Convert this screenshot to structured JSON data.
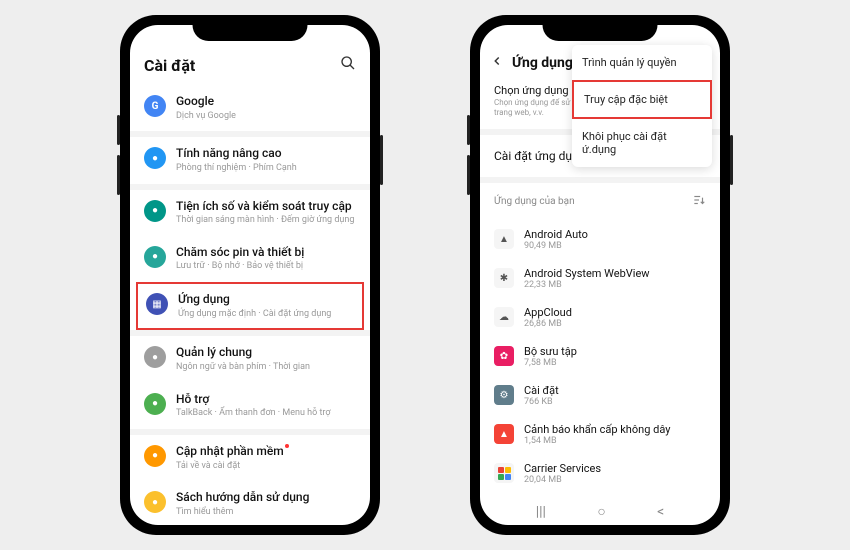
{
  "phone1": {
    "header": {
      "title": "Cài đặt"
    },
    "groups": [
      {
        "items": [
          {
            "title": "Google",
            "sub": "Dịch vụ Google",
            "icon": "google-icon",
            "bg": "bg-blue-g"
          }
        ]
      },
      {
        "items": [
          {
            "title": "Tính năng nâng cao",
            "sub": "Phòng thí nghiệm · Phím Cạnh",
            "icon": "advanced-icon",
            "bg": "bg-blue"
          }
        ]
      },
      {
        "items": [
          {
            "title": "Tiện ích số và kiểm soát truy cập",
            "sub": "Thời gian sáng màn hình · Đếm giờ ứng dụng",
            "icon": "wellbeing-icon",
            "bg": "bg-teal"
          },
          {
            "title": "Chăm sóc pin và thiết bị",
            "sub": "Lưu trữ · Bộ nhớ · Bảo vệ thiết bị",
            "icon": "battery-icon",
            "bg": "bg-teal2"
          },
          {
            "title": "Ứng dụng",
            "sub": "Ứng dụng mặc định · Cài đặt ứng dụng",
            "icon": "apps-icon",
            "bg": "bg-indigo",
            "highlight": true
          }
        ]
      },
      {
        "items": [
          {
            "title": "Quản lý chung",
            "sub": "Ngôn ngữ và bàn phím · Thời gian",
            "icon": "general-icon",
            "bg": "bg-grey"
          },
          {
            "title": "Hỗ trợ",
            "sub": "TalkBack · Ẩm thanh đơn · Menu hỗ trợ",
            "icon": "accessibility-icon",
            "bg": "bg-green"
          }
        ]
      },
      {
        "items": [
          {
            "title": "Cập nhật phần mềm",
            "sub": "Tải về và cài đặt",
            "icon": "update-icon",
            "bg": "bg-orange",
            "red_dot": true
          },
          {
            "title": "Sách hướng dẫn sử dụng",
            "sub": "Tìm hiểu thêm",
            "icon": "manual-icon",
            "bg": "bg-yellow"
          }
        ]
      }
    ]
  },
  "phone2": {
    "header": {
      "title": "Ứng dụng"
    },
    "menu": {
      "items": [
        {
          "label": "Trình quản lý quyền",
          "highlight": false
        },
        {
          "label": "Truy cập đặc biệt",
          "highlight": true
        },
        {
          "label": "Khôi phục cài đặt ứ.dụng",
          "highlight": false
        }
      ]
    },
    "desc": {
      "heading": "Chọn ứng dụng mặc định",
      "sub": "Chọn ứng dụng để sử dụng cho cuộc gọi, tin nhắn, truy cập trang web, v.v."
    },
    "samsung_label": "Cài đặt ứng dụng Samsung",
    "filter_label": "Ứng dụng của bạn",
    "apps": [
      {
        "title": "Android Auto",
        "sub": "90,49 MB",
        "icon": "android-auto-icon",
        "bg": "bg-lt",
        "glyph": "▲",
        "glyphcls": "dark"
      },
      {
        "title": "Android System WebView",
        "sub": "22,33 MB",
        "icon": "webview-icon",
        "bg": "bg-lt",
        "glyph": "✱",
        "glyphcls": "dark"
      },
      {
        "title": "AppCloud",
        "sub": "26,86 MB",
        "icon": "appcloud-icon",
        "bg": "bg-lt",
        "glyph": "☁",
        "glyphcls": "dark"
      },
      {
        "title": "Bộ sưu tập",
        "sub": "7,58 MB",
        "icon": "gallery-icon",
        "bg": "bg-pink",
        "glyph": "✿",
        "glyphcls": ""
      },
      {
        "title": "Cài đặt",
        "sub": "766 KB",
        "icon": "settings-icon",
        "bg": "bg-gear",
        "glyph": "⚙",
        "glyphcls": ""
      },
      {
        "title": "Cảnh báo khẩn cấp không dây",
        "sub": "1,54 MB",
        "icon": "emergency-icon",
        "bg": "bg-redwarn",
        "glyph": "▲",
        "glyphcls": ""
      },
      {
        "title": "Carrier Services",
        "sub": "20,04 MB",
        "icon": "carrier-icon",
        "bg": "bg-lt",
        "glyph": "puzzle",
        "glyphcls": ""
      }
    ]
  }
}
